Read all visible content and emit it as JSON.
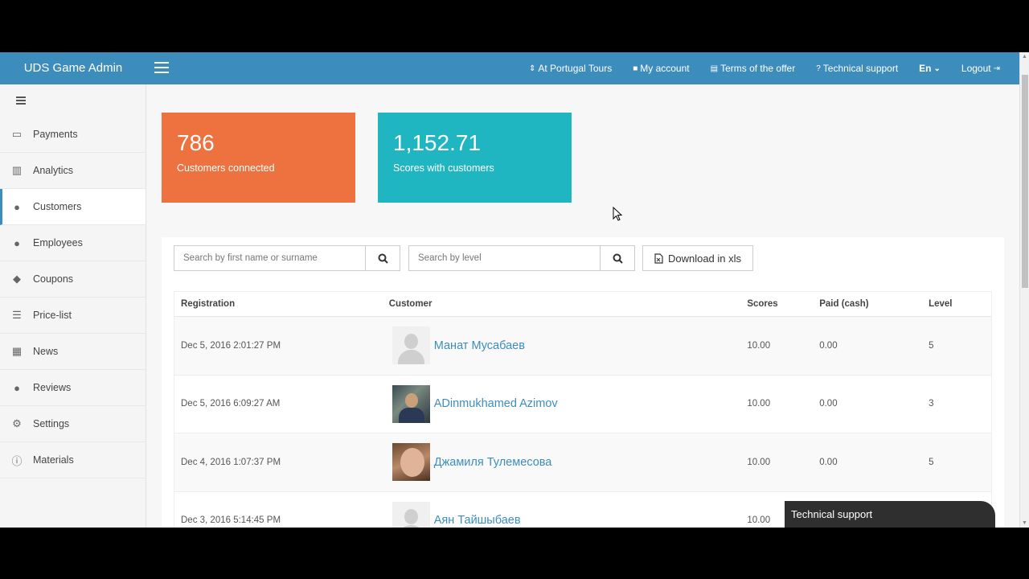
{
  "brand": "UDS Game Admin",
  "topnav": {
    "company": "At Portugal Tours",
    "account": "My account",
    "terms": "Terms of the offer",
    "support": "Technical support",
    "lang": "En",
    "logout": "Logout"
  },
  "sidebar": {
    "items": [
      {
        "label": "Payments",
        "icon": "credit-card-icon"
      },
      {
        "label": "Analytics",
        "icon": "bar-chart-icon"
      },
      {
        "label": "Customers",
        "icon": "users-icon"
      },
      {
        "label": "Employees",
        "icon": "user-icon"
      },
      {
        "label": "Coupons",
        "icon": "ticket-icon"
      },
      {
        "label": "Price-list",
        "icon": "list-icon"
      },
      {
        "label": "News",
        "icon": "newspaper-icon"
      },
      {
        "label": "Reviews",
        "icon": "comment-icon"
      },
      {
        "label": "Settings",
        "icon": "cogs-icon"
      },
      {
        "label": "Materials",
        "icon": "info-icon"
      }
    ]
  },
  "stats": {
    "customers": {
      "value": "786",
      "label": "Customers connected",
      "color": "#ed7240"
    },
    "scores": {
      "value": "1,152.71",
      "label": "Scores with customers",
      "color": "#1fb5c1"
    }
  },
  "filters": {
    "name_placeholder": "Search by first name or surname",
    "level_placeholder": "Search by level",
    "download_label": "Download in xls"
  },
  "table": {
    "headers": {
      "registration": "Registration",
      "customer": "Customer",
      "scores": "Scores",
      "paid": "Paid (cash)",
      "level": "Level"
    },
    "rows": [
      {
        "registration": "Dec 5, 2016 2:01:27 PM",
        "customer": "Манат Мусабаев",
        "scores": "10.00",
        "paid": "0.00",
        "level": "5"
      },
      {
        "registration": "Dec 5, 2016 6:09:27 AM",
        "customer": "ADinmukhamed Azimov",
        "scores": "10.00",
        "paid": "0.00",
        "level": "3"
      },
      {
        "registration": "Dec 4, 2016 1:07:37 PM",
        "customer": "Джамиля Тулемесова",
        "scores": "10.00",
        "paid": "0.00",
        "level": "5"
      },
      {
        "registration": "Dec 3, 2016 5:14:45 PM",
        "customer": "Аян Тайшыбаев",
        "scores": "10.00",
        "paid": "",
        "level": ""
      }
    ]
  },
  "support_widget": "Technical support",
  "accent_color": "#3c8dbc"
}
